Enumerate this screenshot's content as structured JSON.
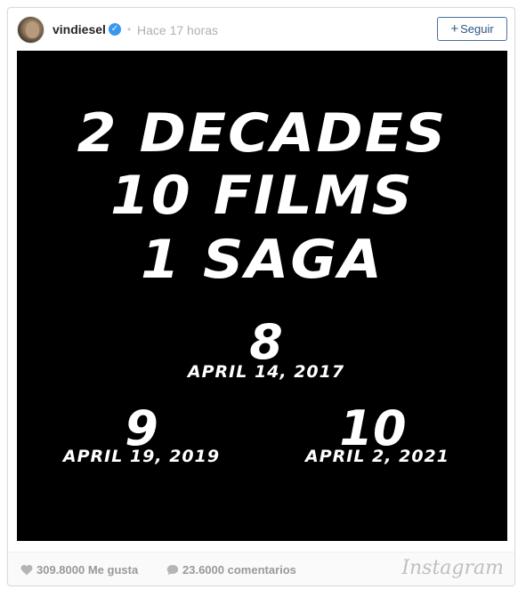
{
  "header": {
    "username": "vindiesel",
    "verified_icon": "verified-check-icon",
    "separator": "•",
    "time_ago": "Hace 17 horas",
    "follow_button": {
      "plus": "+",
      "label": "Seguir"
    }
  },
  "post_image": {
    "line1": "2 DECADES",
    "line2": "10 FILMS",
    "line3": "1 SAGA",
    "release_8": {
      "number": "8",
      "date": "APRIL 14, 2017"
    },
    "release_9": {
      "number": "9",
      "date": "APRIL 19, 2019"
    },
    "release_10": {
      "number": "10",
      "date": "APRIL 2, 2021"
    }
  },
  "footer": {
    "likes": "309.8000 Me gusta",
    "comments": "23.6000 comentarios",
    "brand": "Instagram"
  },
  "colors": {
    "link_blue": "#2d5582",
    "verified_blue": "#3897f0",
    "muted_gray": "#999999",
    "photo_background": "#000000"
  }
}
